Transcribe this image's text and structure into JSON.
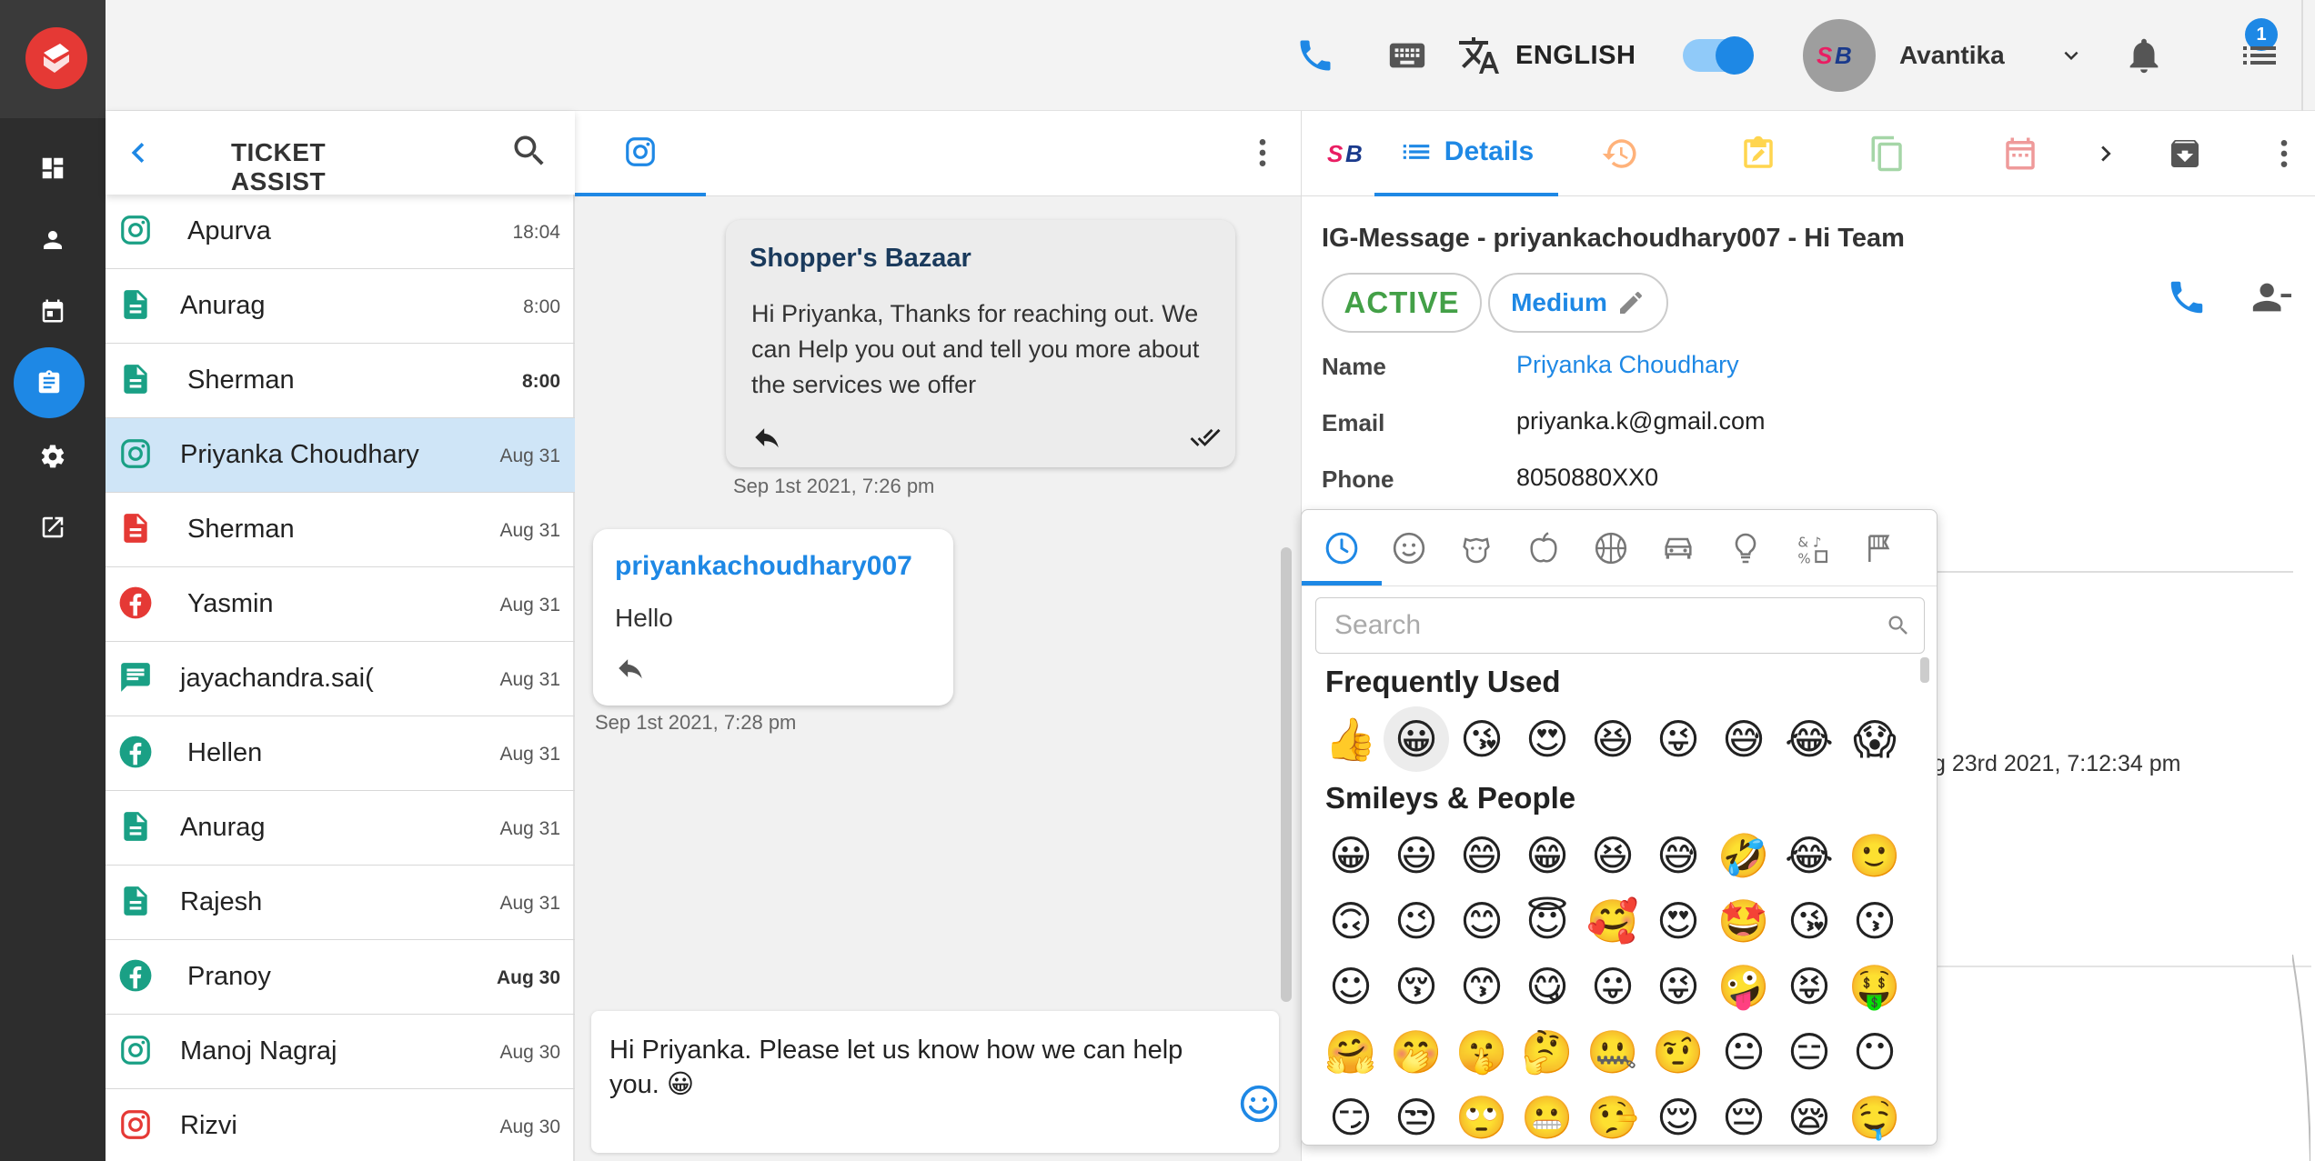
{
  "rail": {
    "items": [
      "dashboard-icon",
      "person-icon",
      "calendar-icon",
      "ticket-icon",
      "gear-icon",
      "external-link-icon"
    ],
    "active": "ticket-icon"
  },
  "topbar": {
    "language": "ENGLISH",
    "avatar_initials": "SB",
    "user_name": "Avantika",
    "notification_count": "1"
  },
  "tickets": {
    "title": "TICKET ASSIST",
    "items": [
      {
        "channel": "instagram",
        "name": "Apurva",
        "time": "18:04",
        "bold": false
      },
      {
        "channel": "document",
        "name": "Anurag",
        "time": "8:00",
        "bold": false
      },
      {
        "channel": "document",
        "name": "Sherman",
        "time": "8:00",
        "bold": true
      },
      {
        "channel": "instagram",
        "name": "Priyanka Choudhary",
        "time": "Aug 31",
        "bold": false,
        "selected": true
      },
      {
        "channel": "document-red",
        "name": "Sherman",
        "time": "Aug 31",
        "bold": false
      },
      {
        "channel": "facebook-red",
        "name": "Yasmin",
        "time": "Aug 31",
        "bold": false
      },
      {
        "channel": "chat",
        "name": "jayachandra.sai(",
        "time": "Aug 31",
        "bold": false
      },
      {
        "channel": "facebook",
        "name": "Hellen",
        "time": "Aug 31",
        "bold": false
      },
      {
        "channel": "document",
        "name": "Anurag",
        "time": "Aug 31",
        "bold": false
      },
      {
        "channel": "document",
        "name": "Rajesh",
        "time": "Aug 31",
        "bold": false
      },
      {
        "channel": "facebook",
        "name": "Pranoy",
        "time": "Aug 30",
        "bold": true
      },
      {
        "channel": "instagram",
        "name": "Manoj Nagraj",
        "time": "Aug 30",
        "bold": false
      },
      {
        "channel": "instagram-red",
        "name": "Rizvi",
        "time": "Aug 30",
        "bold": false
      }
    ]
  },
  "chat": {
    "outgoing": {
      "sender": "Shopper's Bazaar",
      "body": "Hi Priyanka, Thanks for reaching out. We can Help you out and tell you more about the services we offer",
      "time": "Sep 1st 2021, 7:26 pm"
    },
    "incoming": {
      "sender": "priyankachoudhary007",
      "body": "Hello",
      "time": "Sep 1st 2021, 7:28 pm"
    },
    "composer_text": "Hi Priyanka. Please let us know how we can help you. 😀"
  },
  "details": {
    "tab_label": "Details",
    "title": "IG-Message - priyankachoudhary007 - Hi Team",
    "status": "ACTIVE",
    "priority": "Medium",
    "fields": [
      {
        "label": "Name",
        "value": "Priyanka Choudhary",
        "link": true
      },
      {
        "label": "Email",
        "value": "priyanka.k@gmail.com",
        "link": false
      },
      {
        "label": "Phone",
        "value": "8050880XX0",
        "link": false
      }
    ],
    "partial_date": "g 23rd 2021, 7:12:34 pm"
  },
  "emoji_picker": {
    "search_placeholder": "Search",
    "frequently_used_title": "Frequently Used",
    "smileys_title": "Smileys & People",
    "frequently_used": [
      "👍",
      "😀",
      "😘",
      "😍",
      "😆",
      "😜",
      "😅",
      "😂",
      "😱"
    ],
    "smileys": [
      "😀",
      "😃",
      "😄",
      "😁",
      "😆",
      "😅",
      "🤣",
      "😂",
      "🙂",
      "🙃",
      "😉",
      "😊",
      "😇",
      "🥰",
      "😍",
      "🤩",
      "😘",
      "😗",
      "☺",
      "😚",
      "😙",
      "😋",
      "😛",
      "😜",
      "🤪",
      "😝",
      "🤑",
      "🤗",
      "🤭",
      "🤫",
      "🤔",
      "🤐",
      "🤨",
      "😐",
      "😑",
      "😶",
      "😏",
      "😒",
      "🙄",
      "😬",
      "🤥",
      "😌",
      "😔",
      "😪",
      "🤤"
    ]
  },
  "colors": {
    "accent": "#1e88e5",
    "rail": "#2d2d2d",
    "logo_red": "#e53935",
    "active_status": "#43a047"
  }
}
